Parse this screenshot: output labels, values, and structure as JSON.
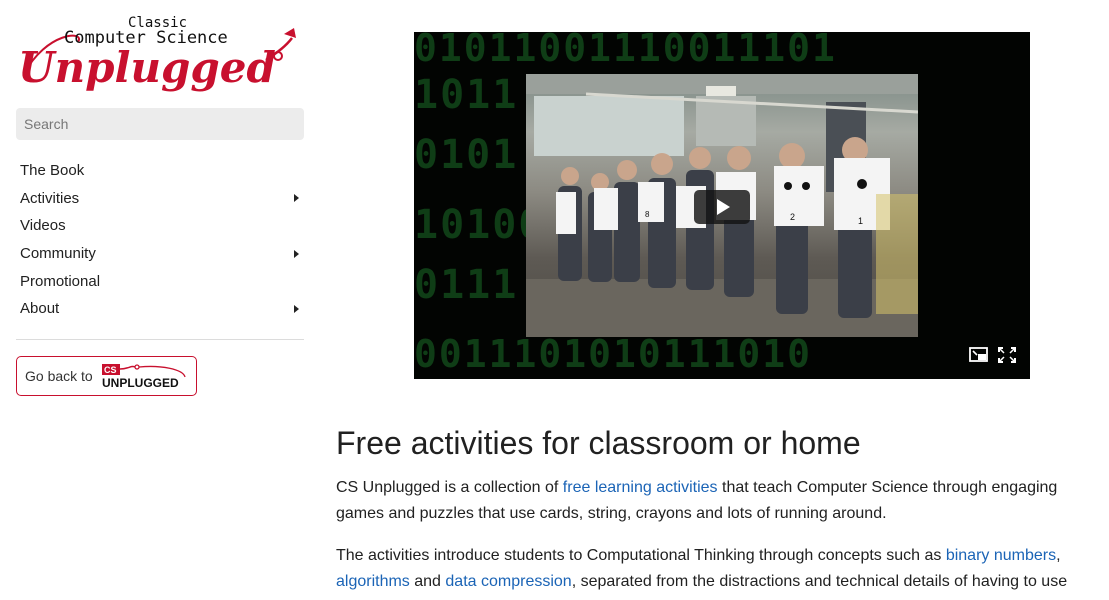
{
  "logo": {
    "classic": "Classic",
    "computer_science": "Computer Science",
    "unplugged": "Unplugged"
  },
  "search": {
    "placeholder": "Search"
  },
  "nav": {
    "items": [
      {
        "label": "The Book",
        "has_submenu": false
      },
      {
        "label": "Activities",
        "has_submenu": true
      },
      {
        "label": "Videos",
        "has_submenu": false
      },
      {
        "label": "Community",
        "has_submenu": true
      },
      {
        "label": "Promotional",
        "has_submenu": false
      },
      {
        "label": "About",
        "has_submenu": true
      }
    ]
  },
  "go_back": {
    "label": "Go back to",
    "logo_cs": "CS",
    "logo_text": "UNPLUGGED"
  },
  "video": {
    "binary_rows": [
      "01011001110011101",
      "1011 1000110101001",
      "0101 0011 11010",
      "1010011 10100111",
      "0111 0101110101",
      "0011101010111010"
    ],
    "sign_labels": [
      "8",
      "2",
      "1"
    ],
    "controls": [
      "play-icon",
      "picture-in-picture-icon",
      "fullscreen-icon"
    ]
  },
  "main": {
    "heading": "Free activities for classroom or home",
    "para1": {
      "t1": "CS Unplugged is a collection of ",
      "link1": "free learning activities",
      "t2": " that teach Computer Science through engaging games and puzzles that use cards, string, crayons and lots of running around."
    },
    "para2": {
      "t1": "The activities introduce students to Computational Thinking through concepts such as ",
      "link1": "binary numbers",
      "t2": ", ",
      "link2": "algorithms",
      "t3": " and ",
      "link3": "data compression",
      "t4": ", separated from the distractions and technical details of having to use"
    }
  },
  "colors": {
    "brand_red": "#c8102e",
    "link_blue": "#1b64b6",
    "text": "#212121",
    "search_bg": "#ececec"
  }
}
